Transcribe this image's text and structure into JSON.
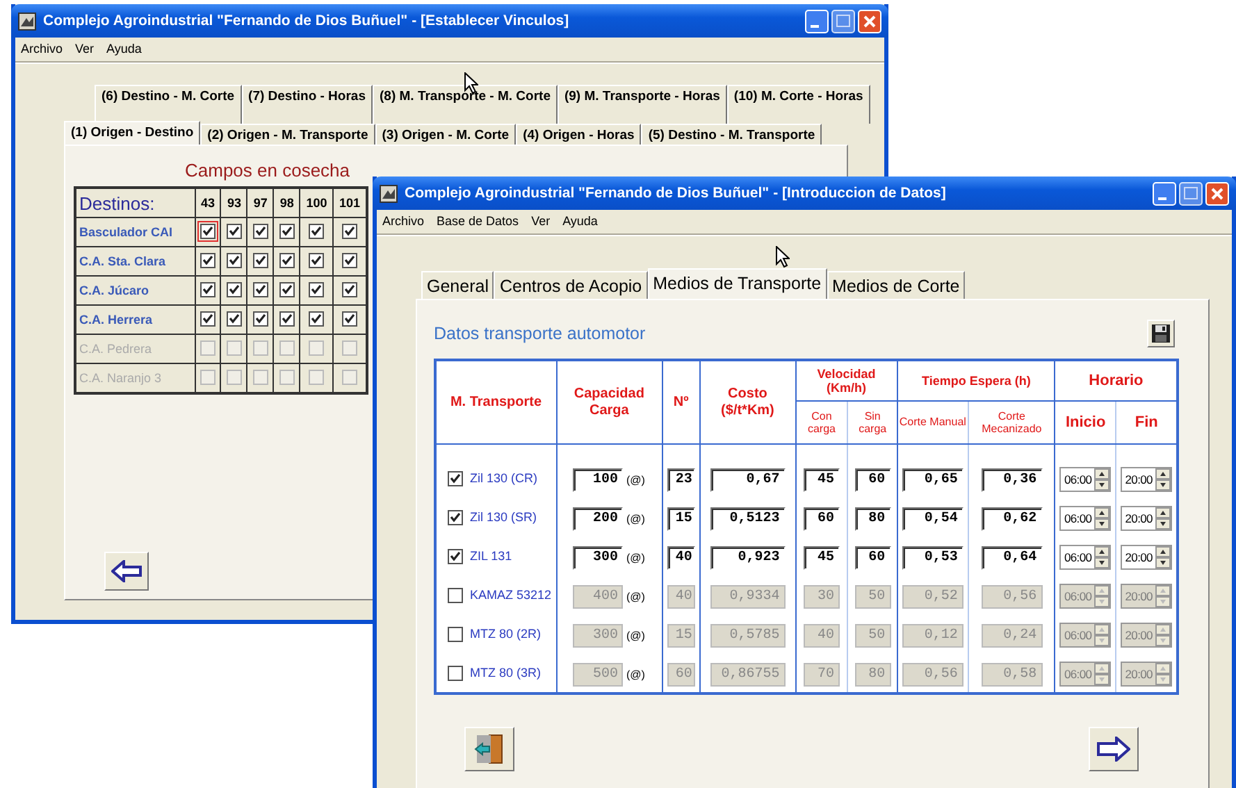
{
  "links_window": {
    "title": "Complejo Agroindustrial \"Fernando de Dios Buñuel\" - [Establecer Vinculos]",
    "menu": [
      "Archivo",
      "Ver",
      "Ayuda"
    ],
    "tab_rows": [
      [
        {
          "label": "(6) Destino - M. Corte",
          "selected": false
        },
        {
          "label": "(7) Destino - Horas",
          "selected": false
        },
        {
          "label": "(8) M. Transporte - M. Corte",
          "selected": false
        },
        {
          "label": "(9) M. Transporte - Horas",
          "selected": false
        },
        {
          "label": "(10) M. Corte - Horas",
          "selected": false
        }
      ],
      [
        {
          "label": "(1) Origen - Destino",
          "selected": true
        },
        {
          "label": "(2) Origen - M. Transporte",
          "selected": false
        },
        {
          "label": "(3) Origen - M. Corte",
          "selected": false
        },
        {
          "label": "(4) Origen - Horas",
          "selected": false
        },
        {
          "label": "(5) Destino - M. Transporte",
          "selected": false
        }
      ]
    ],
    "section_title": "Campos en cosecha",
    "grid": {
      "header": "Destinos:",
      "columns": [
        "43",
        "93",
        "97",
        "98",
        "100",
        "101"
      ],
      "rows": [
        {
          "name": "Basculador CAI",
          "disabled": false,
          "checks": [
            true,
            true,
            true,
            true,
            true,
            true
          ]
        },
        {
          "name": "C.A. Sta. Clara",
          "disabled": false,
          "checks": [
            true,
            true,
            true,
            true,
            true,
            true
          ]
        },
        {
          "name": "C.A. Júcaro",
          "disabled": false,
          "checks": [
            true,
            true,
            true,
            true,
            true,
            true
          ]
        },
        {
          "name": "C.A. Herrera",
          "disabled": false,
          "checks": [
            true,
            true,
            true,
            true,
            true,
            true
          ]
        },
        {
          "name": "C.A. Pedrera",
          "disabled": true,
          "checks": [
            false,
            false,
            false,
            false,
            false,
            false
          ]
        },
        {
          "name": "C.A. Naranjo 3",
          "disabled": true,
          "checks": [
            false,
            false,
            false,
            false,
            false,
            false
          ]
        }
      ]
    }
  },
  "data_window": {
    "title": "Complejo Agroindustrial \"Fernando de Dios Buñuel\" - [Introduccion de Datos]",
    "menu": [
      "Archivo",
      "Base de Datos",
      "Ver",
      "Ayuda"
    ],
    "tabs": [
      {
        "label": "General",
        "selected": false
      },
      {
        "label": "Centros de Acopio",
        "selected": false
      },
      {
        "label": "Medios de Transporte",
        "selected": true
      },
      {
        "label": "Medios de Corte",
        "selected": false
      }
    ],
    "section_title": "Datos transporte automotor",
    "columns": [
      {
        "label": "M. Transporte"
      },
      {
        "label": "Capacidad Carga"
      },
      {
        "label": "Nº"
      },
      {
        "label": "Costo ($/t*Km)"
      },
      {
        "label": "Velocidad (Km/h)",
        "sub": [
          "Con carga",
          "Sin carga"
        ]
      },
      {
        "label": "Tiempo Espera (h)",
        "sub": [
          "Corte Manual",
          "Corte Mecanizado"
        ]
      },
      {
        "label": "Horario",
        "sub": [
          "Inicio",
          "Fin"
        ]
      }
    ],
    "rows": [
      {
        "name": "Zil 130 (CR)",
        "checked": true,
        "capacity": "100",
        "unit": "(@)",
        "count": "23",
        "cost": "0,67",
        "speed_loaded": "45",
        "speed_empty": "60",
        "wait_manual": "0,65",
        "wait_mechanized": "0,36",
        "start": "06:00",
        "end": "20:00"
      },
      {
        "name": "Zil 130 (SR)",
        "checked": true,
        "capacity": "200",
        "unit": "(@)",
        "count": "15",
        "cost": "0,5123",
        "speed_loaded": "60",
        "speed_empty": "80",
        "wait_manual": "0,54",
        "wait_mechanized": "0,62",
        "start": "06:00",
        "end": "20:00"
      },
      {
        "name": "ZIL 131",
        "checked": true,
        "capacity": "300",
        "unit": "(@)",
        "count": "40",
        "cost": "0,923",
        "speed_loaded": "45",
        "speed_empty": "60",
        "wait_manual": "0,53",
        "wait_mechanized": "0,64",
        "start": "06:00",
        "end": "20:00"
      },
      {
        "name": "KAMAZ 53212",
        "checked": false,
        "capacity": "400",
        "unit": "(@)",
        "count": "40",
        "cost": "0,9334",
        "speed_loaded": "30",
        "speed_empty": "50",
        "wait_manual": "0,52",
        "wait_mechanized": "0,56",
        "start": "06:00",
        "end": "20:00"
      },
      {
        "name": "MTZ 80 (2R)",
        "checked": false,
        "capacity": "300",
        "unit": "(@)",
        "count": "15",
        "cost": "0,5785",
        "speed_loaded": "40",
        "speed_empty": "50",
        "wait_manual": "0,12",
        "wait_mechanized": "0,24",
        "start": "06:00",
        "end": "20:00"
      },
      {
        "name": "MTZ 80 (3R)",
        "checked": false,
        "capacity": "500",
        "unit": "(@)",
        "count": "60",
        "cost": "0,86755",
        "speed_loaded": "70",
        "speed_empty": "80",
        "wait_manual": "0,56",
        "wait_mechanized": "0,58",
        "start": "06:00",
        "end": "20:00"
      }
    ]
  }
}
